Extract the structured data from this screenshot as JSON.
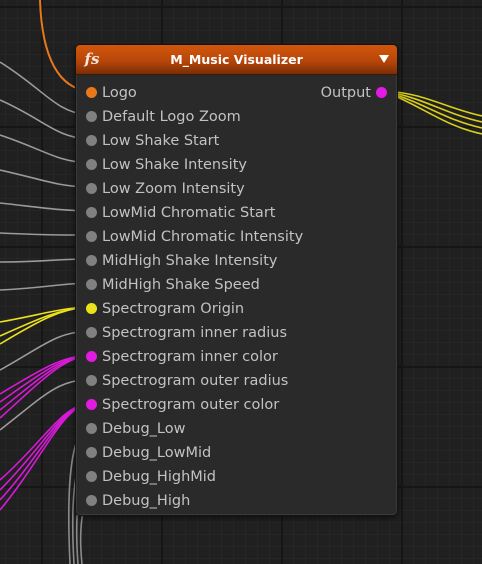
{
  "node": {
    "title": "M_Music Visualizer",
    "icon": "fs-function-icon",
    "icon_glyph": "fs",
    "accent_color": "#c4500b"
  },
  "inputs": [
    {
      "label": "Logo",
      "color": "#e8781a"
    },
    {
      "label": "Default Logo Zoom",
      "color": "#808080"
    },
    {
      "label": "Low Shake Start",
      "color": "#808080"
    },
    {
      "label": "Low Shake Intensity",
      "color": "#808080"
    },
    {
      "label": "Low Zoom Intensity",
      "color": "#808080"
    },
    {
      "label": "LowMid Chromatic Start",
      "color": "#808080"
    },
    {
      "label": "LowMid Chromatic Intensity",
      "color": "#808080"
    },
    {
      "label": "MidHigh Shake Intensity",
      "color": "#808080"
    },
    {
      "label": "MidHigh Shake Speed",
      "color": "#808080"
    },
    {
      "label": "Spectrogram Origin",
      "color": "#ece11c"
    },
    {
      "label": "Spectrogram inner radius",
      "color": "#808080"
    },
    {
      "label": "Spectrogram inner color",
      "color": "#e21be2"
    },
    {
      "label": "Spectrogram outer radius",
      "color": "#808080"
    },
    {
      "label": "Spectrogram outer color",
      "color": "#e21be2"
    },
    {
      "label": "Debug_Low",
      "color": "#808080"
    },
    {
      "label": "Debug_LowMid",
      "color": "#808080"
    },
    {
      "label": "Debug_HighMid",
      "color": "#808080"
    },
    {
      "label": "Debug_High",
      "color": "#808080"
    }
  ],
  "output": {
    "label": "Output",
    "color": "#e21be2"
  },
  "wire_colors": {
    "float": "#9a9a9a",
    "texture": "#e8781a",
    "vector2": "#ece11c",
    "color": "#d61ad6",
    "output": "#d9cf1a"
  }
}
